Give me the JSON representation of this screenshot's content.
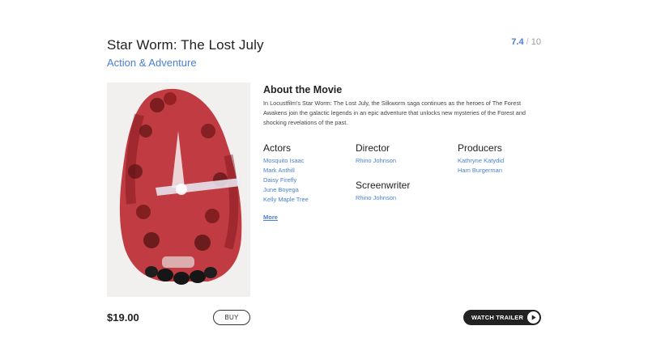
{
  "movie": {
    "title": "Star Worm: The Lost July",
    "genre": "Action & Adventure",
    "rating": {
      "score": "7.4",
      "separator": "/",
      "max": "10"
    },
    "poster_icon": "movie-poster-image"
  },
  "about": {
    "heading": "About the Movie",
    "text": "In Locustfilm's Star Worm: The Lost July, the Silkworm saga continues as the heroes of The Forest Awakens join the galactic legends in an epic adventure that unlocks new mysteries of the Forest and shocking revelations of the past."
  },
  "credits": {
    "actors": {
      "heading": "Actors",
      "names": [
        "Mosquito Isaac",
        "Mark Anthill",
        "Daisy Firefly",
        "June Boyega",
        "Kelly Maple Tree"
      ]
    },
    "director": {
      "heading": "Director",
      "names": [
        "Rhino Johnson"
      ]
    },
    "screenwriter": {
      "heading": "Screenwriter",
      "names": [
        "Rhino Johnson"
      ]
    },
    "producers": {
      "heading": "Producers",
      "names": [
        "Kathryne Katydid",
        "Ham Burgerman"
      ]
    },
    "more_label": "More"
  },
  "purchase": {
    "price": "$19.00",
    "buy_label": "BUY",
    "trailer_label": "WATCH TRAILER"
  },
  "colors": {
    "accent": "#4a7fd4",
    "text": "#222222",
    "button_dark": "#222222"
  }
}
